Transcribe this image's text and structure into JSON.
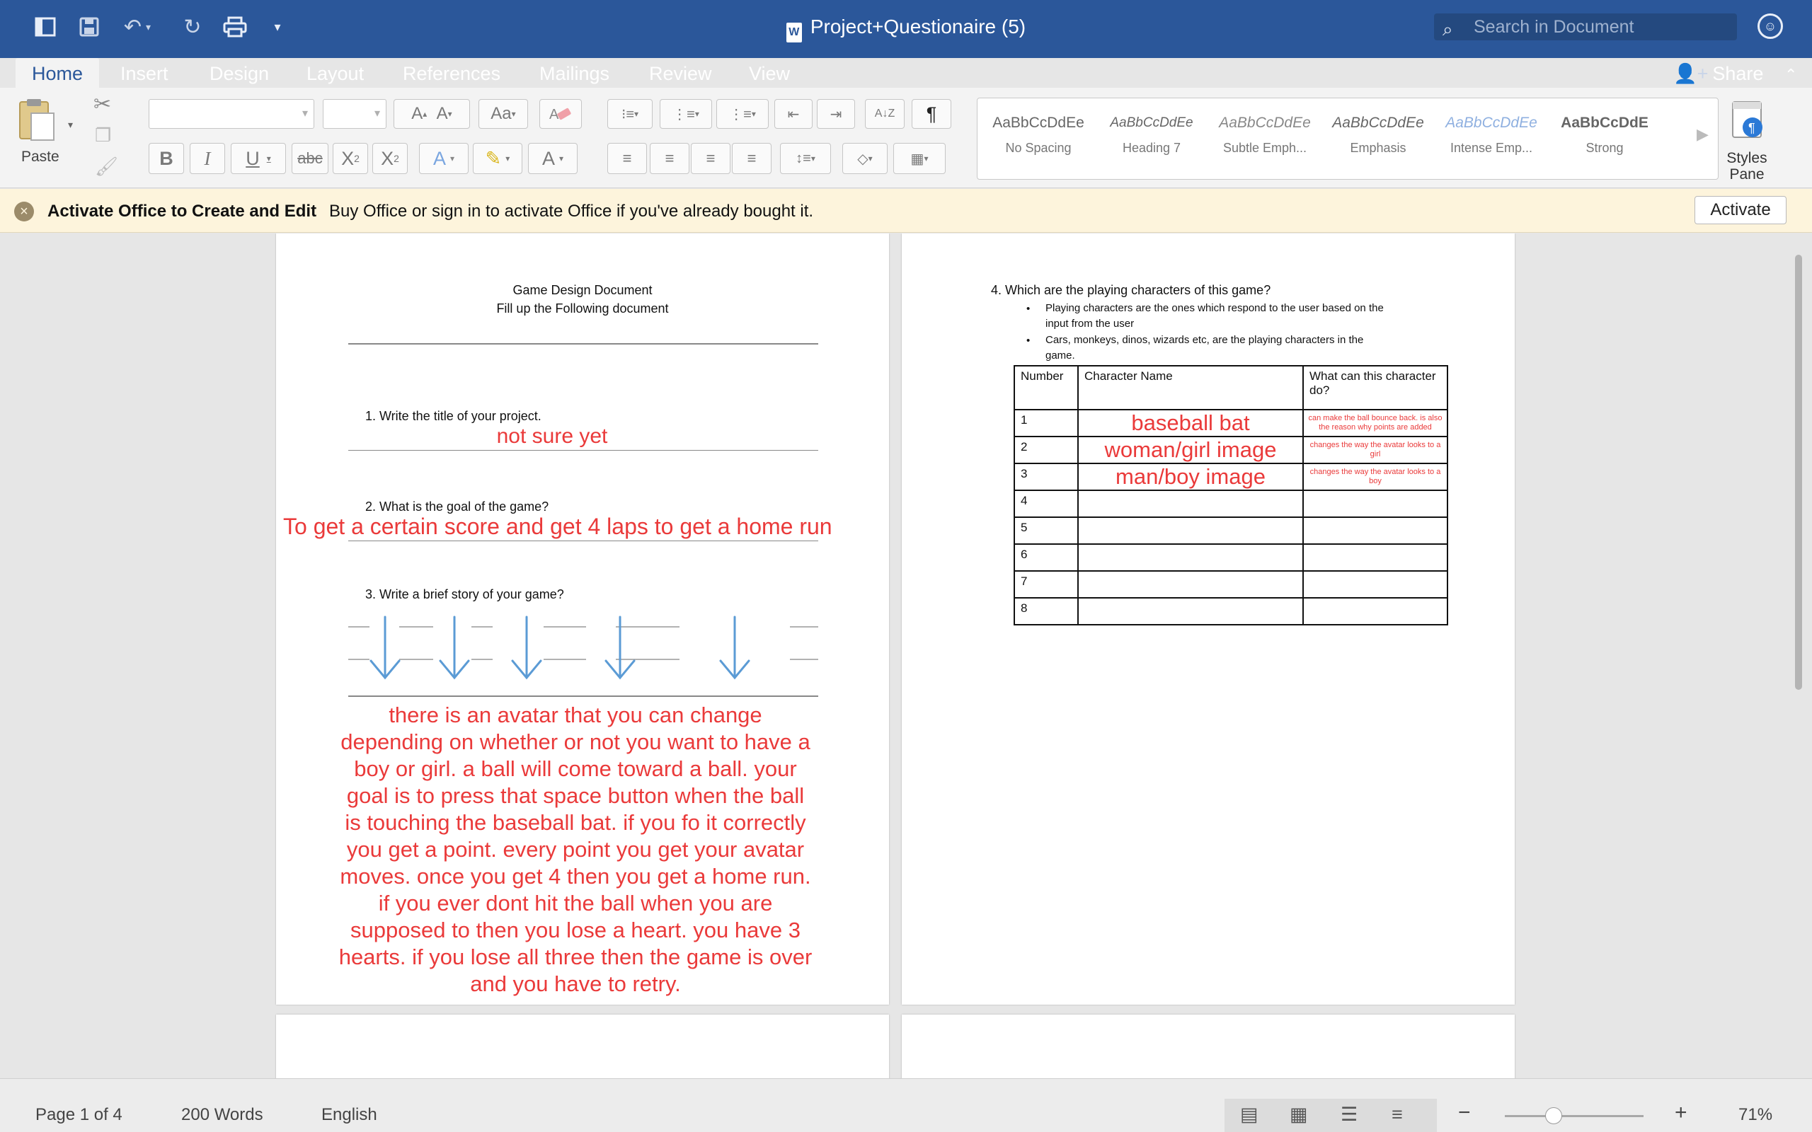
{
  "window": {
    "title": "Project+Questionaire (5)",
    "search_placeholder": "Search in Document"
  },
  "tabs": [
    "Home",
    "Insert",
    "Design",
    "Layout",
    "References",
    "Mailings",
    "Review",
    "View"
  ],
  "share_label": "Share",
  "ribbon": {
    "paste_label": "Paste",
    "styles": [
      {
        "preview": "AaBbCcDdEe",
        "name": "No Spacing"
      },
      {
        "preview": "AaBbCcDdEe",
        "name": "Heading 7"
      },
      {
        "preview": "AaBbCcDdEe",
        "name": "Subtle Emph..."
      },
      {
        "preview": "AaBbCcDdEe",
        "name": "Emphasis"
      },
      {
        "preview": "AaBbCcDdEe",
        "name": "Intense Emp..."
      },
      {
        "preview": "AaBbCcDdE",
        "name": "Strong"
      }
    ],
    "styles_pane_label": "Styles Pane"
  },
  "notification": {
    "title": "Activate Office to Create and Edit",
    "message": "Buy Office or sign in to activate Office if you've already bought it.",
    "button": "Activate"
  },
  "page1": {
    "heading1": "Game Design Document",
    "heading2": "Fill up the Following document",
    "q1": "1.  Write the title of your project.",
    "a1": "not sure yet",
    "q2": "2.  What is the goal of the game?",
    "a2": "To get a certain score and get 4 laps to get a home run",
    "q3": "3.  Write a brief story of your game?",
    "a3_lines": [
      "there is an avatar that you can change",
      "depending on whether or not you want to have a",
      "boy or girl. a ball will come toward a ball. your",
      "goal is to press that space button when the ball",
      "is touching the baseball bat. if you fo it correctly",
      "you get a point. every point you get your avatar",
      "moves. once you get 4 then you get a home run.",
      "if you ever dont hit the ball when you are",
      "supposed to then you lose a heart. you have 3",
      "hearts. if you lose all three then the game is over",
      "and you have to retry."
    ]
  },
  "page2": {
    "q4": "4.  Which are the playing characters of this game?",
    "bullet1_line1": "Playing characters are the ones which respond to the user based on the",
    "bullet1_line2": "input from the user",
    "bullet2_line1": "Cars, monkeys, dinos, wizards etc, are the playing characters in the",
    "bullet2_line2": "game.",
    "table_headers": [
      "Number",
      "Character Name",
      "What can this character do?"
    ],
    "rows": [
      {
        "num": "1",
        "name": "baseball bat",
        "does": "can make the ball bounce back. is also the reason why points are added"
      },
      {
        "num": "2",
        "name": "woman/girl image",
        "does": "changes the way the avatar looks to a girl"
      },
      {
        "num": "3",
        "name": "man/boy image",
        "does": "changes the way the avatar looks to a boy"
      },
      {
        "num": "4",
        "name": "",
        "does": ""
      },
      {
        "num": "5",
        "name": "",
        "does": ""
      },
      {
        "num": "6",
        "name": "",
        "does": ""
      },
      {
        "num": "7",
        "name": "",
        "does": ""
      },
      {
        "num": "8",
        "name": "",
        "does": ""
      }
    ]
  },
  "status": {
    "page": "Page 1 of 4",
    "words": "200 Words",
    "language": "English",
    "zoom": "71%",
    "zoom_minus": "−",
    "zoom_plus": "+"
  },
  "colors": {
    "brand": "#2b579a",
    "annotation_red": "#ea3a3a",
    "arrow_blue": "#5b9bd5"
  }
}
